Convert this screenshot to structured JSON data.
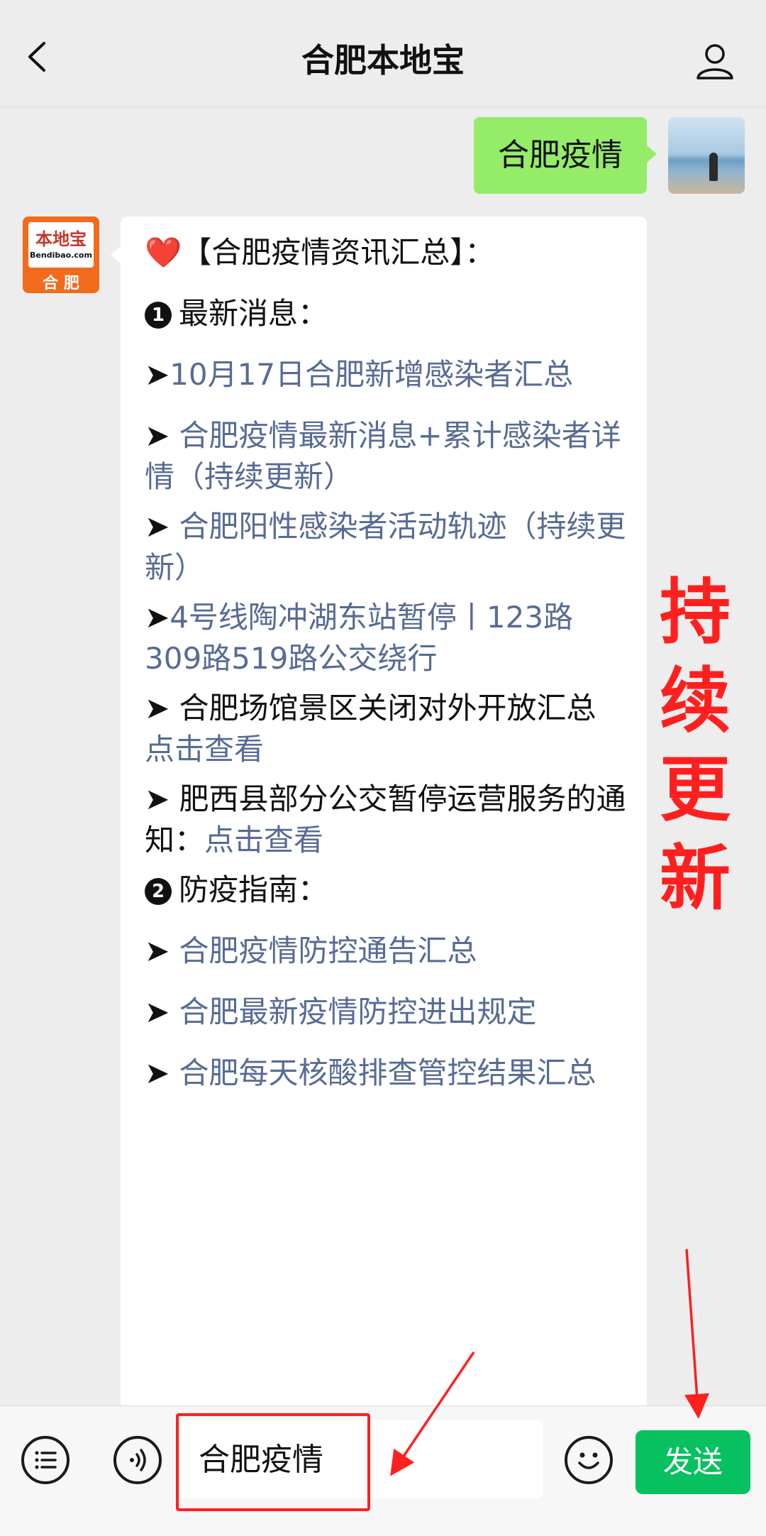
{
  "header": {
    "title": "合肥本地宝"
  },
  "messages": {
    "outgoing": "合肥疫情",
    "bot_logo": {
      "main": "本地宝",
      "sub": "Bendibao.com",
      "city": "合 肥"
    },
    "incoming": {
      "heading_prefix": "❤️",
      "heading": "【合肥疫情资讯汇总】：",
      "section1_num": "❶",
      "section1": "最新消息：",
      "items1": [
        {
          "arrow": "➤",
          "link": "10月17日合肥新增感染者汇总",
          "text": ""
        },
        {
          "arrow": "➤",
          "link": " 合肥疫情最新消息+累计感染者详情（持续更新）",
          "text": ""
        },
        {
          "arrow": "➤",
          "link": " 合肥阳性感染者活动轨迹（持续更新）",
          "text": ""
        },
        {
          "arrow": "➤",
          "link": "4号线陶冲湖东站暂停丨123路309路519路公交绕行",
          "text": ""
        },
        {
          "arrow": "➤",
          "text": " 合肥场馆景区关闭对外开放汇总",
          "link": "点击查看"
        },
        {
          "arrow": "➤",
          "text": " 肥西县部分公交暂停运营服务的通知：",
          "link": "点击查看"
        }
      ],
      "section2_num": "❷",
      "section2": "防疫指南：",
      "items2": [
        {
          "arrow": "➤",
          "link": " 合肥疫情防控通告汇总"
        },
        {
          "arrow": "➤",
          "link": " 合肥最新疫情防控进出规定"
        },
        {
          "arrow": "➤",
          "link": " 合肥每天核酸排查管控结果汇总"
        }
      ]
    }
  },
  "annotation": {
    "side_note": "持续更新"
  },
  "input": {
    "value": "合肥疫情",
    "send_label": "发送"
  },
  "colors": {
    "link": "#576b95",
    "send": "#07c160",
    "outgoing_bubble": "#95ec69",
    "annotation": "#ff1f1f"
  }
}
